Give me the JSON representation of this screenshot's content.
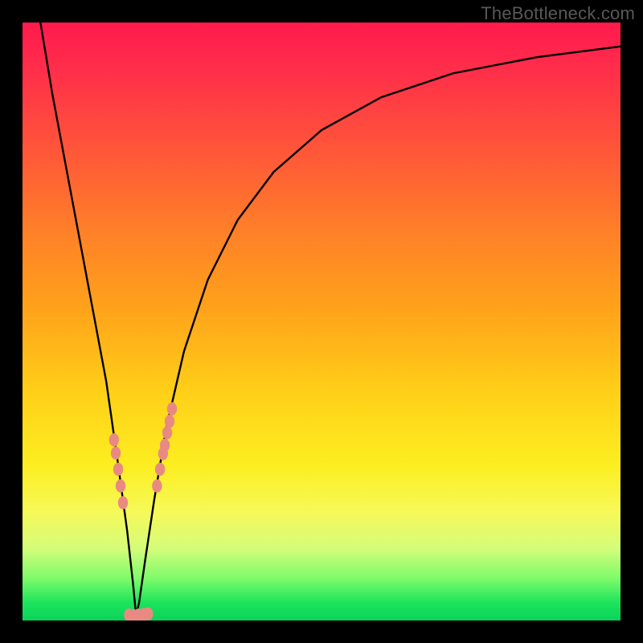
{
  "watermark": {
    "text": "TheBottleneck.com"
  },
  "chart_data": {
    "type": "line",
    "title": "",
    "xlabel": "",
    "ylabel": "",
    "xlim": [
      0,
      100
    ],
    "ylim": [
      0,
      100
    ],
    "grid": false,
    "description": "Bottleneck-percentage curve on rainbow gradient (red=high bottleneck at top, green=0% at bottom). Minimum near x≈19.",
    "series": [
      {
        "name": "bottleneck-curve",
        "x": [
          3,
          5,
          8,
          11,
          14,
          16,
          17.5,
          18.5,
          19,
          19.5,
          20.5,
          22,
          24,
          27,
          31,
          36,
          42,
          50,
          60,
          72,
          86,
          100
        ],
        "values": [
          100,
          88,
          72,
          56,
          40,
          26,
          15,
          6,
          0.8,
          3,
          10,
          20,
          32,
          45,
          57,
          67,
          75,
          82,
          87.5,
          91.5,
          94.2,
          96
        ]
      }
    ],
    "markers": {
      "name": "data-points",
      "color": "#e98a82",
      "points": [
        {
          "x": 15.3,
          "y": 30.2
        },
        {
          "x": 15.6,
          "y": 28.0
        },
        {
          "x": 16.0,
          "y": 25.3
        },
        {
          "x": 16.4,
          "y": 22.5
        },
        {
          "x": 16.8,
          "y": 19.7
        },
        {
          "x": 17.8,
          "y": 0.9
        },
        {
          "x": 18.6,
          "y": 0.8
        },
        {
          "x": 19.4,
          "y": 0.9
        },
        {
          "x": 20.3,
          "y": 1.0
        },
        {
          "x": 21.0,
          "y": 1.1
        },
        {
          "x": 22.5,
          "y": 22.5
        },
        {
          "x": 23.0,
          "y": 25.3
        },
        {
          "x": 23.5,
          "y": 27.9
        },
        {
          "x": 23.8,
          "y": 29.3
        },
        {
          "x": 24.2,
          "y": 31.4
        },
        {
          "x": 24.6,
          "y": 33.3
        },
        {
          "x": 25.0,
          "y": 35.4
        }
      ]
    },
    "gradient_stops": [
      {
        "pct": 0,
        "meaning": "max-bottleneck",
        "color": "#ff1a4d"
      },
      {
        "pct": 50,
        "meaning": "mid",
        "color": "#ffd018"
      },
      {
        "pct": 100,
        "meaning": "no-bottleneck",
        "color": "#09d35a"
      }
    ]
  }
}
